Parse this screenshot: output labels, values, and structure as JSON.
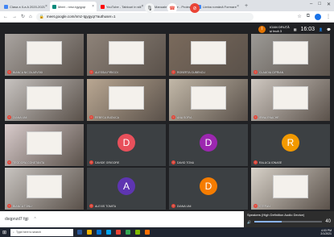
{
  "browser": {
    "tabs": [
      {
        "label": "Clasa a II-a A 2020-2021",
        "favicon": "#4285f4"
      },
      {
        "label": "Meet - nmz-tgygyqr",
        "favicon": "#00897b",
        "active": true
      },
      {
        "label": "YouTube - Tablouri in stil",
        "favicon": "#ff0000"
      },
      {
        "label": "Manuale Digitale - Proiect",
        "favicon": "#0b8043"
      },
      {
        "label": "Limba română Formare",
        "favicon": "#4285f4"
      }
    ],
    "url": "meet.google.com/nmz-tgygyqr?authuser=1"
  },
  "meet": {
    "self_initial": "I",
    "top_name": "IOAN DRUȚĂ",
    "top_sub": "și încă 3",
    "clock": "16:03",
    "tiles": [
      {
        "name": "BIANCA NICOLAEVSKI",
        "kind": "video",
        "bg": "#a9a4a0"
      },
      {
        "name": "ALESSIA PIRIGOI",
        "kind": "video",
        "bg": "#8e8379"
      },
      {
        "name": "ROBERTA GUBENCU",
        "kind": "video",
        "bg": "#7a6a5c"
      },
      {
        "name": "CLAUDIA CIPRIAN",
        "kind": "video",
        "bg": "#9c9a96"
      },
      {
        "name": "DIANA UNI",
        "kind": "video",
        "bg": "#c7c3c0"
      },
      {
        "name": "REBECA BUDUCA",
        "kind": "video",
        "bg": "#b9a792"
      },
      {
        "name": "ANA SOFIA",
        "kind": "video",
        "bg": "#c2b8a8"
      },
      {
        "name": "IRINA ENACHE",
        "kind": "video",
        "bg": "#cfc8c1"
      },
      {
        "name": "TEODORA CONSTANTA",
        "kind": "video",
        "bg": "#d8cbcb"
      },
      {
        "name": "DAVIDE GRIGORE",
        "kind": "avatar",
        "initial": "D",
        "color": "#e8505b"
      },
      {
        "name": "DAVID TONU",
        "kind": "avatar",
        "initial": "D",
        "color": "#9c27b0"
      },
      {
        "name": "MARCO CRACIUN",
        "kind": "avatar",
        "initial": "M",
        "color": "#8e24aa"
      },
      {
        "name": "RALUCA IONASE",
        "kind": "avatar",
        "initial": "R",
        "color": "#f29900"
      },
      {
        "name": "BIANCA TONU",
        "kind": "video",
        "bg": "#c8c4c0"
      },
      {
        "name": "ALEXIS TOMITA",
        "kind": "avatar",
        "initial": "A",
        "color": "#5e35b1"
      },
      {
        "name": "DIANA UNI",
        "kind": "avatar",
        "initial": "D",
        "color": "#f57c00"
      },
      {
        "name": "ȘTEFAN",
        "kind": "video",
        "bg": "#d7d1c8"
      }
    ],
    "meeting_code": "dsqpnzd7 fgji",
    "speaker_popup": {
      "label": "Speakers (High Definition Audio Device)",
      "volume": 40
    }
  },
  "taskbar": {
    "search_placeholder": "Type here to search",
    "tray_time": "4:03 PM",
    "tray_date": "2/1/2021",
    "icons": [
      "#2b5797",
      "#f4b400",
      "#0078d7",
      "#00a4ef",
      "#ea4335",
      "#34a853",
      "#7fba00",
      "#ff6f00"
    ]
  }
}
